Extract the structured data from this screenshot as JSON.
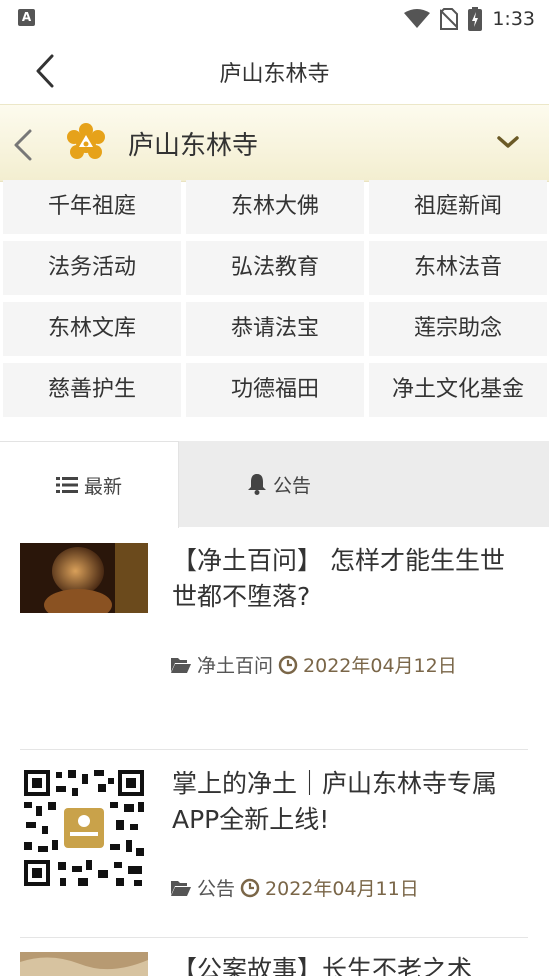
{
  "status": {
    "time": "1:33",
    "app_badge": "A"
  },
  "topbar": {
    "title": "庐山东林寺"
  },
  "sitebar": {
    "name": "庐山东林寺"
  },
  "grid": [
    "千年祖庭",
    "东林大佛",
    "祖庭新闻",
    "法务活动",
    "弘法教育",
    "东林法音",
    "东林文库",
    "恭请法宝",
    "莲宗助念",
    "慈善护生",
    "功德福田",
    "净土文化基金"
  ],
  "tabs": {
    "latest": "最新",
    "notice": "公告"
  },
  "articles": [
    {
      "title": "【净土百问】 怎样才能生生世世都不堕落?",
      "category": "净土百问",
      "date": "2022年04月12日"
    },
    {
      "title": "掌上的净土｜庐山东林寺专属APP全新上线!",
      "category": "公告",
      "date": "2022年04月11日"
    },
    {
      "title": "【公案故事】长生不老之术"
    }
  ],
  "colors": {
    "accent": "#7a6648",
    "logo": "#e6a21a",
    "sitebar_bg": "#f6f2da"
  }
}
